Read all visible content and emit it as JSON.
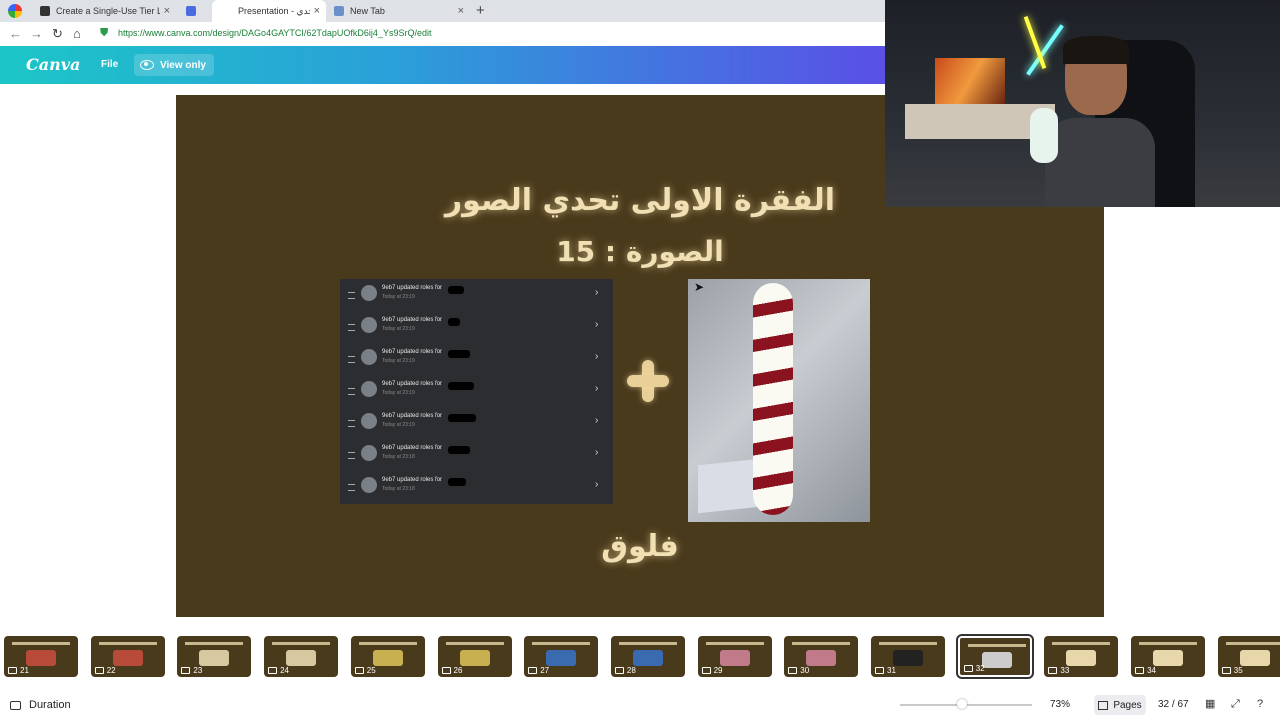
{
  "browser": {
    "tabs": [
      {
        "title": "Create a Single-Use Tier List (",
        "favicon_color": "#333333"
      },
      {
        "title": "",
        "favicon_color": "#4b6be0"
      },
      {
        "title": "Presentation - تحدي",
        "favicon_color": "#1cc6c7",
        "active": true
      },
      {
        "title": "New Tab",
        "favicon_color": "#6a8fc9"
      }
    ],
    "new_tab_label": "+",
    "close_label": "×",
    "url": "https://www.canva.com/design/DAGo4GAYTCI/62TdapUOfkD6ij4_Ys9SrQ/edit"
  },
  "canva": {
    "logo": "Canva",
    "file_label": "File",
    "view_only_label": "View only"
  },
  "slide": {
    "title_line1": "الفقرة الاولى تحدي الصور",
    "title_line2": "الصورة : 15",
    "footer_label": "فلوق",
    "background": "#4a3a1c",
    "discord_rows": [
      {
        "text": "9eb7 updated roles for",
        "time": "Today at 23:19"
      },
      {
        "text": "9eb7 updated roles for",
        "time": "Today at 23:19"
      },
      {
        "text": "9eb7 updated roles for",
        "time": "Today at 23:19"
      },
      {
        "text": "9eb7 updated roles for",
        "time": "Today at 23:19"
      },
      {
        "text": "9eb7 updated roles for",
        "time": "Today at 23:19"
      },
      {
        "text": "9eb7 updated roles for",
        "time": "Today at 23:18"
      },
      {
        "text": "9eb7 updated roles for",
        "time": "Today at 23:18"
      }
    ]
  },
  "thumbnails": [
    {
      "num": "21"
    },
    {
      "num": "22"
    },
    {
      "num": "23"
    },
    {
      "num": "24"
    },
    {
      "num": "25"
    },
    {
      "num": "26"
    },
    {
      "num": "27"
    },
    {
      "num": "28"
    },
    {
      "num": "29"
    },
    {
      "num": "30"
    },
    {
      "num": "31"
    },
    {
      "num": "32",
      "selected": true
    },
    {
      "num": "33"
    },
    {
      "num": "34"
    },
    {
      "num": "35"
    }
  ],
  "footer": {
    "duration_label": "Duration",
    "zoom": "73%",
    "zoom_fraction": 0.47,
    "pages_label": "Pages",
    "page_count": "32 / 67"
  }
}
